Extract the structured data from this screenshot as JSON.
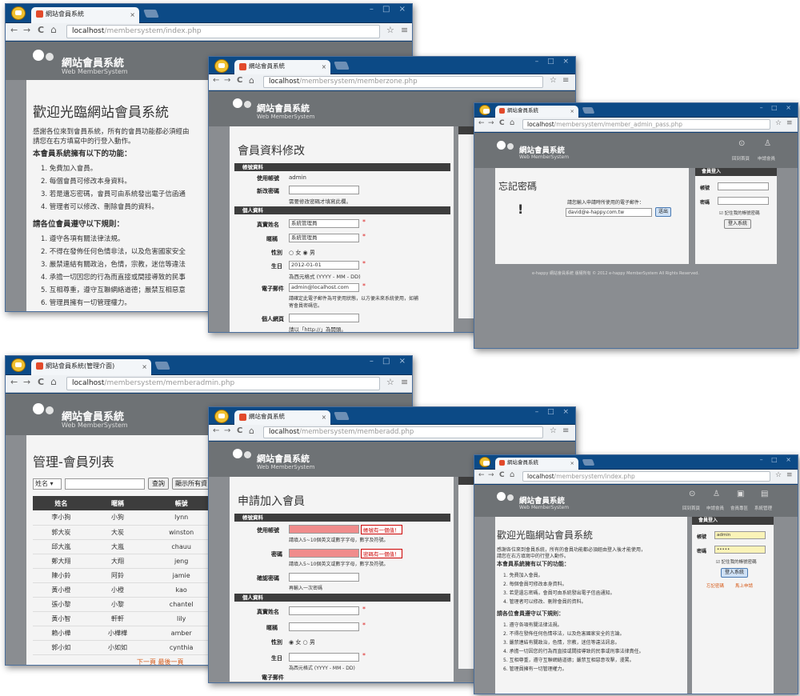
{
  "common": {
    "site_name": "網站會員系統",
    "site_sub": "Web MemberSystem",
    "host": "localhost",
    "nav_back": "←",
    "nav_fwd": "→",
    "nav_reload": "C",
    "nav_home": "⌂",
    "star": "☆",
    "menu": "≡",
    "tab_close": "×",
    "window_controls": "– □ ×"
  },
  "win1": {
    "tab": "網站會員系統",
    "path": "/membersystem/index.php",
    "title": "歡迎光臨網站會員系統",
    "intro": "感謝各位來到會員系統，所有的會員功能都必須經由",
    "intro2": "請您在右方填寫中的行登入動作。",
    "features_title": "本會員系統擁有以下的功能：",
    "features": [
      "1. 免費加入會員。",
      "2. 每個會員可修改本身資料。",
      "3. 若是遺忘密碼，會員可由系統發出電子信函通",
      "4. 管理者可以修改、刪除會員的資料。"
    ],
    "rules_title": "請各位會員遵守以下規則：",
    "rules": [
      "1. 遵守各項有關法律法規。",
      "2. 不得在發佈任何色情非法，以及危害國家安全",
      "3. 嚴禁連結有關政治，色情，宗教，迷信等違法",
      "4. 承擔一切因您的行為而直接或間接導致的民事",
      "5. 互相尊重，遵守互聯網絡道德；嚴禁互相惡意",
      "6. 管理員擁有一切管理權力。"
    ]
  },
  "win2": {
    "tab": "網站會員系統",
    "path": "/membersystem/memberzone.php",
    "title": "會員資料修改",
    "sec_account": "帳號資料",
    "l_user": "使用帳號",
    "v_user": "admin",
    "l_pass": "新改密碼",
    "hint_pass": "需要修改密碼才填寫此欄。",
    "sec_person": "個人資料",
    "l_name": "真實姓名",
    "v_name": "系統管理員",
    "l_nick": "暱稱",
    "v_nick": "系統管理員",
    "l_gender": "性別",
    "gender_opts": "○ 女 ◉ 男",
    "l_birth": "生日",
    "v_birth": "2012-01-01",
    "hint_birth": "為西元格式 (YYYY - MM - DD)",
    "l_email": "電子郵件",
    "v_email": "admin@localhost.com",
    "hint_email": "請確定此電子郵件為可使用狀態，以方便未來系統使用，如補",
    "hint_email2": "寄會員密碼信。",
    "l_web": "個人網頁",
    "hint_web": "請以「http://」為開頭。"
  },
  "win3": {
    "tab": "網站會員系統",
    "path": "/membersystem/member_admin_pass.php",
    "title": "忘記密碼",
    "prompt": "請您輸入申請時所使用的電子郵件：",
    "email": "david@e-happy.com.tw",
    "send": "送出",
    "nav_items": [
      "回到首頁",
      "申請會員"
    ],
    "login_title": "會員登入",
    "l_acct": "帳號",
    "l_pass": "密碼",
    "remember": "☑ 記住我的帳號密碼",
    "login_btn": "登入系統",
    "footer": "e-happy 網站會員系統 版權所有 © 2012 e-happy MemberSystem All Rights Reserved."
  },
  "win4": {
    "tab": "網站會員系統(管理介面)",
    "path": "/membersystem/memberadmin.php",
    "title": "管理-會員列表",
    "filter": "姓名",
    "search": "查詢",
    "showall": "顯示所有資",
    "headers": [
      "姓名",
      "暱稱",
      "帳號"
    ],
    "rows": [
      [
        "李小狗",
        "小狗",
        "lynn"
      ],
      [
        "郭大炭",
        "大炭",
        "winston"
      ],
      [
        "邱大嵐",
        "大嵐",
        "chauu"
      ],
      [
        "鄭大翔",
        "大翔",
        "jeng"
      ],
      [
        "陳小鈴",
        "阿鈴",
        "jamie"
      ],
      [
        "黃小橙",
        "小橙",
        "kao"
      ],
      [
        "張小黎",
        "小黎",
        "chantel"
      ],
      [
        "黃小智",
        "軒軒",
        "lily"
      ],
      [
        "賴小樺",
        "小樺樺",
        "amber"
      ],
      [
        "郭小如",
        "小如如",
        "cynthia"
      ]
    ],
    "pager": "下一頁 最後一頁"
  },
  "win5": {
    "tab": "網站會員系統",
    "path": "/membersystem/memberadd.php",
    "title": "申請加入會員",
    "sec_account": "帳號資料",
    "l_user": "使用帳號",
    "warn1": "帳號有一個值！",
    "hint_user": "請填入5~10個英文或數字字母，數字及符號。",
    "l_pass": "密碼",
    "warn2": "密碼有一個值！",
    "hint_pass": "請填入5~10個英文或數字字母，數字及符號。",
    "l_confirm": "確認密碼",
    "hint_confirm": "再輸入一次密碼",
    "sec_person": "個人資料",
    "l_name": "真實姓名",
    "l_nick": "暱稱",
    "l_gender": "性別",
    "gender_opts": "◉ 女 ○ 男",
    "l_birth": "生日",
    "hint_birth": "為西元格式 (YYYY - MM - DD)",
    "l_email": "電子郵件"
  },
  "win6": {
    "tab": "網站會員系統",
    "path": "/membersystem/index.php",
    "nav_items": [
      "回到首頁",
      "申請會員",
      "會員專區",
      "系統管理"
    ],
    "title": "歡迎光臨網站會員系統",
    "intro": "感謝各位來到會員系統，所有的會員功能都必須經由登入後才能使用，",
    "intro2": "請您在右方填寫中的行登入動作。",
    "features_title": "本會員系統擁有以下的功能：",
    "features": [
      "1. 免費加入會員。",
      "2. 每個會員可修改本身資料。",
      "3. 若是遺忘密碼，會員可由系統發出電子信函通知。",
      "4. 管理者可以修改、刪除會員的資料。"
    ],
    "rules_title": "請各位會員遵守以下規則：",
    "rules": [
      "1. 遵守各項有關法律法規。",
      "2. 不得在發佈任何色情非法，以及危害國家安全的言論。",
      "3. 嚴禁連結有關政治，色情，宗教，迷信等違法訊息。",
      "4. 承擔一切因您的行為而直接或間接導致的民事或刑事法律責任。",
      "5. 互相尊重，遵守互聯網絡道德；嚴禁互相惡意攻擊，漫罵。",
      "6. 管理員擁有一切管理權力。"
    ],
    "login_title": "會員登入",
    "l_acct": "帳號",
    "v_acct": "admin",
    "l_pass": "密碼",
    "v_pass": "•••••",
    "remember": "☑ 記住我的帳號密碼",
    "login_btn": "登入系統",
    "forgot": "忘記密碼",
    "join": "馬上申請"
  }
}
